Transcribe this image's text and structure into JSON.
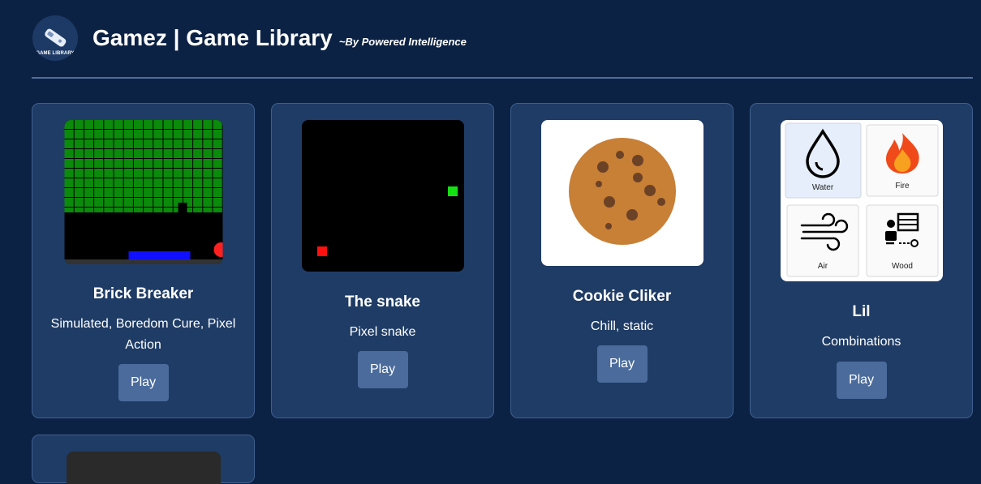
{
  "header": {
    "logo_text": "GAME LIBRARY",
    "title": "Gamez | Game Library",
    "subtitle": "~By Powered Intelligence"
  },
  "games": [
    {
      "title": "Brick Breaker",
      "tags": "Simulated, Boredom Cure, Pixel Action",
      "play_label": "Play"
    },
    {
      "title": "The snake",
      "tags": "Pixel snake",
      "play_label": "Play"
    },
    {
      "title": "Cookie Cliker",
      "tags": "Chill, static",
      "play_label": "Play"
    },
    {
      "title": "Lil",
      "tags": "Combinations",
      "play_label": "Play",
      "elements": [
        "Water",
        "Fire",
        "Air",
        "Wood"
      ]
    }
  ],
  "colors": {
    "background": "#0c2244",
    "card": "#1f3c66",
    "button": "#4a6b9b"
  }
}
